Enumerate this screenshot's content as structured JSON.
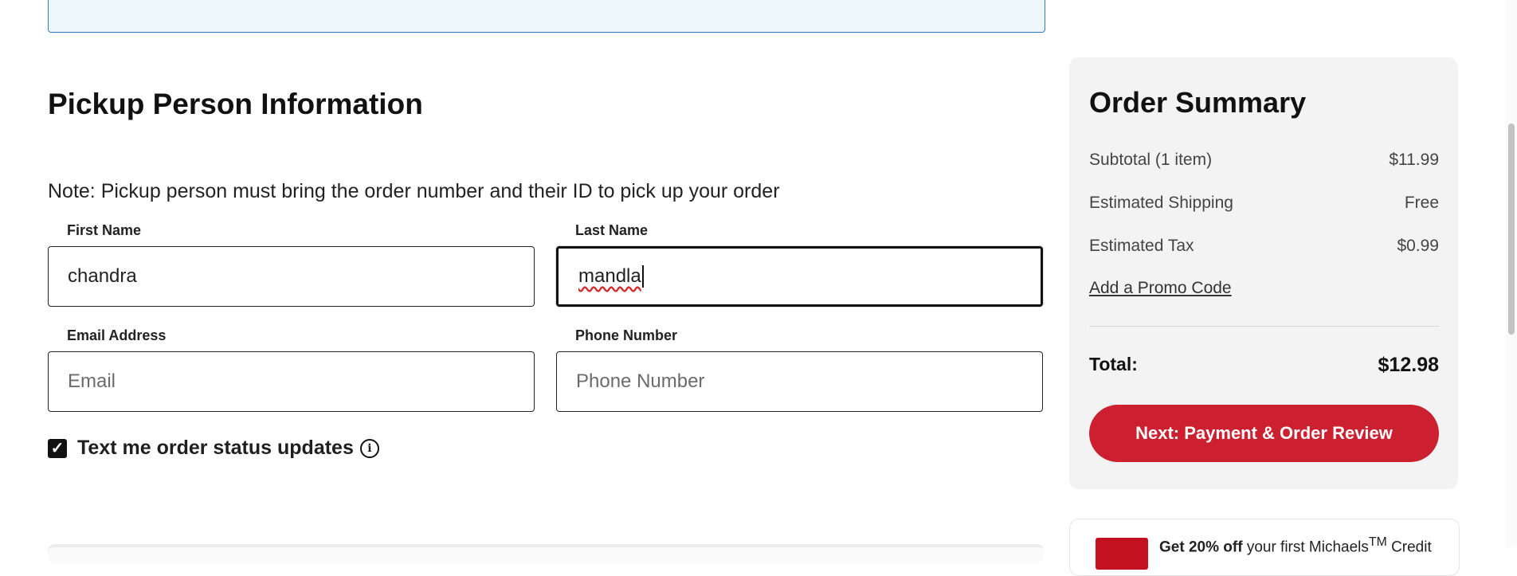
{
  "pickup": {
    "title": "Pickup Person Information",
    "note": "Note: Pickup person must bring the order number and their ID to pick up your order",
    "first_name": {
      "label": "First Name",
      "value": "chandra"
    },
    "last_name": {
      "label": "Last Name",
      "value": "mandla"
    },
    "email": {
      "label": "Email Address",
      "placeholder": "Email",
      "value": ""
    },
    "phone": {
      "label": "Phone Number",
      "placeholder": "Phone Number",
      "value": ""
    },
    "sms_optin": {
      "label": "Text me order status updates",
      "checked": true
    }
  },
  "summary": {
    "title": "Order Summary",
    "subtotal_label": "Subtotal (1 item)",
    "subtotal_value": "$11.99",
    "shipping_label": "Estimated Shipping",
    "shipping_value": "Free",
    "tax_label": "Estimated Tax",
    "tax_value": "$0.99",
    "promo_label": "Add a Promo Code",
    "total_label": "Total:",
    "total_value": "$12.98",
    "next_button": "Next: Payment & Order Review"
  },
  "credit_offer": {
    "bold": "Get 20% off",
    "rest": "your first Michaels",
    "tm": "TM",
    "tail": "Credit"
  },
  "colors": {
    "accent_red": "#cc1f2f",
    "banner_border": "#2a7fbf",
    "summary_bg": "#f3f3f3"
  }
}
